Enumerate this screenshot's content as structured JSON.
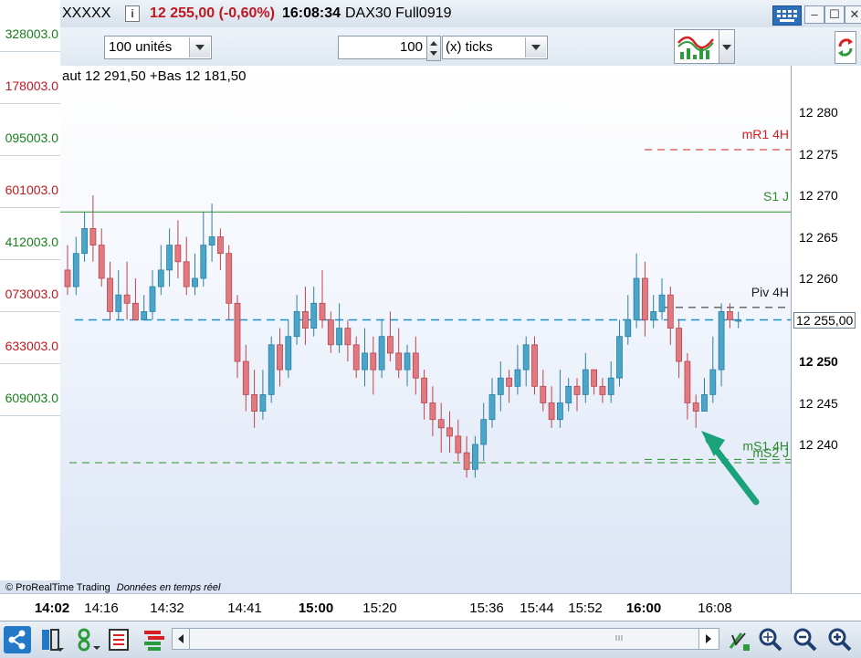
{
  "left_list": [
    {
      "value": "328003.0",
      "color": "green"
    },
    {
      "value": "178003.0",
      "color": "red"
    },
    {
      "value": "095003.0",
      "color": "green"
    },
    {
      "value": "601003.0",
      "color": "red"
    },
    {
      "value": "412003.0",
      "color": "green"
    },
    {
      "value": "073003.0",
      "color": "red"
    },
    {
      "value": "633003.0",
      "color": "red"
    },
    {
      "value": "609003.0",
      "color": "green"
    }
  ],
  "titlebar": {
    "instrument": "XXXXX",
    "price_change": "12 255,00 (-0,60%)",
    "time": "16:08:34",
    "contract": "DAX30 Full0919"
  },
  "toolbar": {
    "units_value": "100 unités",
    "ticks_value": "100",
    "ticks_unit": "(x) ticks"
  },
  "chart": {
    "header": "aut 12 291,50 +Bas 12 181,50",
    "credit": "© ProRealTime Trading",
    "credit_note": "Données en temps réel",
    "current_price_label": "12 255,00",
    "levels": [
      {
        "label": "mR1 4H",
        "price": 12275.5,
        "color": "#d32020",
        "style": "dashed"
      },
      {
        "label": "S1 J",
        "price": 12268,
        "color": "#2e8b2e",
        "style": "solid"
      },
      {
        "label": "Piv 4H",
        "price": 12256.5,
        "color": "#222222",
        "style": "dashed"
      },
      {
        "label": "mS1 4H",
        "price": 12238.2,
        "color": "#2e8b2e",
        "style": "dashed"
      },
      {
        "label": "mS2 J",
        "price": 12237.8,
        "color": "#2e8b2e",
        "style": "dashed"
      }
    ],
    "price_ticks": [
      {
        "label": "12 280",
        "price": 12280,
        "bold": false
      },
      {
        "label": "12 275",
        "price": 12275,
        "bold": false
      },
      {
        "label": "12 270",
        "price": 12270,
        "bold": false
      },
      {
        "label": "12 265",
        "price": 12265,
        "bold": false
      },
      {
        "label": "12 260",
        "price": 12260,
        "bold": false
      },
      {
        "label": "12 250",
        "price": 12250,
        "bold": true
      },
      {
        "label": "12 245",
        "price": 12245,
        "bold": false
      },
      {
        "label": "12 240",
        "price": 12240,
        "bold": false
      }
    ],
    "time_ticks": [
      {
        "label": "14:02",
        "bold": true
      },
      {
        "label": "14:16",
        "bold": false
      },
      {
        "label": "14:32",
        "bold": false
      },
      {
        "label": "14:41",
        "bold": false
      },
      {
        "label": "15:00",
        "bold": true
      },
      {
        "label": "15:20",
        "bold": false
      },
      {
        "label": "15:36",
        "bold": false
      },
      {
        "label": "15:44",
        "bold": false
      },
      {
        "label": "15:52",
        "bold": false
      },
      {
        "label": "16:00",
        "bold": true
      },
      {
        "label": "16:08",
        "bold": false
      }
    ]
  },
  "chart_data": {
    "type": "candlestick",
    "price_range": [
      12232,
      12283
    ],
    "current_price": 12255,
    "candles": [
      [
        12261,
        12259,
        12264,
        12258
      ],
      [
        12259,
        12263,
        12265,
        12258
      ],
      [
        12263,
        12266,
        12268,
        12262
      ],
      [
        12266,
        12264,
        12270,
        12262
      ],
      [
        12264,
        12260,
        12266,
        12259
      ],
      [
        12260,
        12256,
        12262,
        12255
      ],
      [
        12256,
        12258,
        12261,
        12255
      ],
      [
        12258,
        12257,
        12262,
        12255
      ],
      [
        12257,
        12255,
        12260,
        12255
      ],
      [
        12255,
        12256,
        12258,
        12255
      ],
      [
        12256,
        12259,
        12261,
        12255
      ],
      [
        12259,
        12261,
        12264,
        12258
      ],
      [
        12261,
        12264,
        12266,
        12259
      ],
      [
        12264,
        12262,
        12267,
        12260
      ],
      [
        12262,
        12259,
        12265,
        12258
      ],
      [
        12259,
        12260,
        12263,
        12258
      ],
      [
        12260,
        12264,
        12268,
        12259
      ],
      [
        12264,
        12265,
        12269,
        12262
      ],
      [
        12265,
        12263,
        12266,
        12261
      ],
      [
        12263,
        12257,
        12264,
        12255
      ],
      [
        12257,
        12250,
        12258,
        12248
      ],
      [
        12250,
        12246,
        12252,
        12244
      ],
      [
        12246,
        12244,
        12249,
        12242
      ],
      [
        12244,
        12246,
        12249,
        12243
      ],
      [
        12246,
        12252,
        12253,
        12245
      ],
      [
        12252,
        12249,
        12254,
        12247
      ],
      [
        12249,
        12253,
        12255,
        12248
      ],
      [
        12253,
        12256,
        12258,
        12252
      ],
      [
        12256,
        12254,
        12259,
        12252
      ],
      [
        12254,
        12257,
        12259,
        12253
      ],
      [
        12257,
        12255,
        12261,
        12254
      ],
      [
        12255,
        12252,
        12256,
        12251
      ],
      [
        12252,
        12254,
        12257,
        12251
      ],
      [
        12254,
        12252,
        12255,
        12250
      ],
      [
        12252,
        12249,
        12253,
        12248
      ],
      [
        12249,
        12251,
        12254,
        12247
      ],
      [
        12251,
        12249,
        12253,
        12246
      ],
      [
        12249,
        12253,
        12255,
        12248
      ],
      [
        12253,
        12251,
        12256,
        12250
      ],
      [
        12251,
        12249,
        12254,
        12248
      ],
      [
        12249,
        12251,
        12252,
        12247
      ],
      [
        12251,
        12248,
        12253,
        12246
      ],
      [
        12248,
        12245,
        12249,
        12243
      ],
      [
        12245,
        12243,
        12247,
        12241
      ],
      [
        12243,
        12242,
        12245,
        12239
      ],
      [
        12242,
        12241,
        12244,
        12239
      ],
      [
        12241,
        12239,
        12243,
        12238
      ],
      [
        12239,
        12237,
        12241,
        12236
      ],
      [
        12237,
        12240,
        12241,
        12236
      ],
      [
        12240,
        12243,
        12245,
        12238
      ],
      [
        12243,
        12246,
        12248,
        12242
      ],
      [
        12246,
        12248,
        12250,
        12244
      ],
      [
        12248,
        12247,
        12249,
        12245
      ],
      [
        12247,
        12249,
        12252,
        12246
      ],
      [
        12249,
        12252,
        12253,
        12247
      ],
      [
        12252,
        12247,
        12253,
        12246
      ],
      [
        12247,
        12245,
        12249,
        12244
      ],
      [
        12245,
        12243,
        12247,
        12242
      ],
      [
        12243,
        12245,
        12249,
        12242
      ],
      [
        12245,
        12247,
        12248,
        12244
      ],
      [
        12247,
        12246,
        12248,
        12244
      ],
      [
        12246,
        12249,
        12251,
        12245
      ],
      [
        12249,
        12247,
        12249,
        12246
      ],
      [
        12247,
        12246,
        12248,
        12245
      ],
      [
        12246,
        12248,
        12250,
        12245
      ],
      [
        12248,
        12253,
        12255,
        12247
      ],
      [
        12253,
        12255,
        12258,
        12252
      ],
      [
        12255,
        12260,
        12263,
        12254
      ],
      [
        12260,
        12255,
        12262,
        12253
      ],
      [
        12255,
        12256,
        12258,
        12254
      ],
      [
        12256,
        12258,
        12260,
        12255
      ],
      [
        12258,
        12254,
        12259,
        12252
      ],
      [
        12254,
        12250,
        12255,
        12248
      ],
      [
        12250,
        12245,
        12251,
        12243
      ],
      [
        12245,
        12244,
        12246,
        12242
      ],
      [
        12244,
        12246,
        12248,
        12244
      ],
      [
        12246,
        12249,
        12253,
        12245
      ],
      [
        12249,
        12256,
        12257,
        12247
      ],
      [
        12256,
        12255,
        12257,
        12254
      ],
      [
        12255,
        12255,
        12256,
        12254
      ]
    ]
  }
}
